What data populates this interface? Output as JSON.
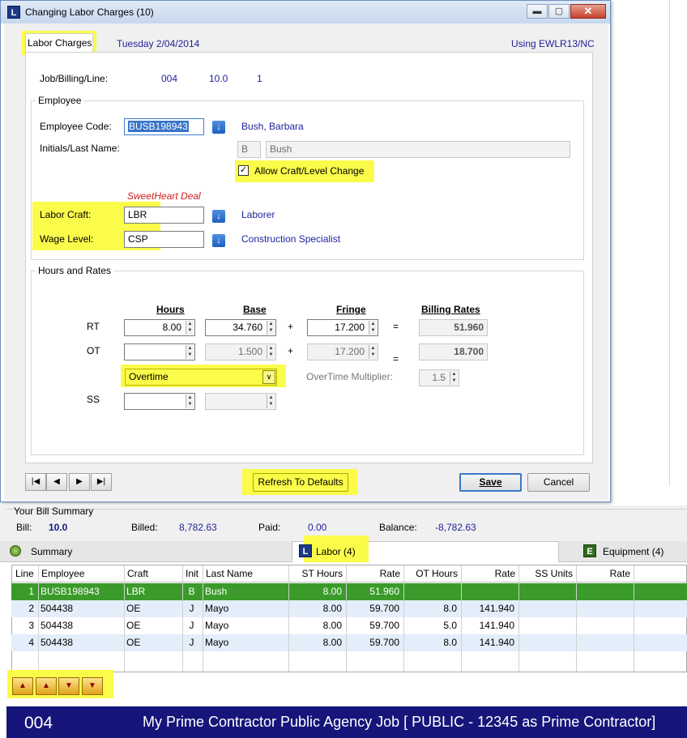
{
  "dialog": {
    "icon": "L",
    "title": "Changing Labor Charges  (10)",
    "tab": "Labor Charges",
    "date": "Tuesday  2/04/2014",
    "using": "Using EWLR13/NC",
    "job_billing_line_label": "Job/Billing/Line:",
    "job": "004",
    "billing": "10.0",
    "line": "1",
    "employee_group_label": "Employee",
    "employee_code_label": "Employee Code:",
    "employee_code": "BUSB198943",
    "employee_name": "Bush, Barbara",
    "initials_label": "Initials/Last Name:",
    "initials": "B",
    "last_name": "Bush",
    "allow_craft_label": "Allow Craft/Level Change",
    "allow_craft_checked": true,
    "sweetheart": "SweetHeart Deal",
    "labor_craft_label": "Labor Craft:",
    "labor_craft": "LBR",
    "labor_craft_desc": "Laborer",
    "wage_level_label": "Wage Level:",
    "wage_level": "CSP",
    "wage_level_desc": "Construction Specialist",
    "hours_group_label": "Hours and Rates",
    "hdr_hours": "Hours",
    "hdr_base": "Base",
    "hdr_fringe": "Fringe",
    "hdr_billing": "Billing Rates",
    "rt_label": "RT",
    "rt_hours": "8.00",
    "rt_base": "34.760",
    "rt_fringe": "17.200",
    "rt_billing": "51.960",
    "ot_label": "OT",
    "ot_hours": "",
    "ot_base": "1.500",
    "ot_fringe": "17.200",
    "ot_billing": "18.700",
    "plus": "+",
    "equals": "=",
    "overtime_select": "Overtime",
    "ot_multiplier_label": "OverTime Multiplier:",
    "ot_multiplier": "1.5",
    "ss_label": "SS",
    "refresh_label": "Refresh To Defaults",
    "save_label": "Save",
    "cancel_label": "Cancel"
  },
  "summary": {
    "heading": "Your Bill Summary",
    "bill_label": "Bill:",
    "bill": "10.0",
    "billed_label": "Billed:",
    "billed": "8,782.63",
    "paid_label": "Paid:",
    "paid": "0.00",
    "balance_label": "Balance:",
    "balance": "-8,782.63"
  },
  "tabs": {
    "summary": "Summary",
    "labor": "Labor (4)",
    "equipment": "Equipment (4)"
  },
  "grid": {
    "columns": [
      "Line",
      "Employee",
      "Craft",
      "Init",
      "Last Name",
      "ST Hours",
      "Rate",
      "OT Hours",
      "Rate",
      "SS Units",
      "Rate"
    ],
    "rows": [
      [
        "1",
        "BUSB198943",
        "LBR",
        "B",
        "Bush",
        "8.00",
        "51.960",
        "",
        "",
        "",
        ""
      ],
      [
        "2",
        "504438",
        "OE",
        "J",
        "Mayo",
        "8.00",
        "59.700",
        "8.0",
        "141.940",
        "",
        ""
      ],
      [
        "3",
        "504438",
        "OE",
        "J",
        "Mayo",
        "8.00",
        "59.700",
        "5.0",
        "141.940",
        "",
        ""
      ],
      [
        "4",
        "504438",
        "OE",
        "J",
        "Mayo",
        "8.00",
        "59.700",
        "8.0",
        "141.940",
        "",
        ""
      ]
    ]
  },
  "footer": {
    "job": "004",
    "description": "My Prime Contractor Public Agency Job  [ PUBLIC - 12345 as Prime Contractor]"
  },
  "colors": {
    "highlight": "#fbfb4a",
    "selected_row": "#3a9b2a",
    "footer_bg": "#15157a"
  }
}
